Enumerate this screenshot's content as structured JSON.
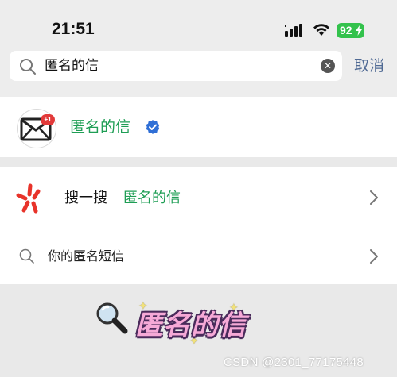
{
  "status_bar": {
    "time": "21:51",
    "battery": "92",
    "icons": [
      "signal-icon",
      "wifi-icon",
      "battery-icon"
    ]
  },
  "search": {
    "value": "匿名的信",
    "cancel_label": "取消",
    "icons": [
      "search-icon",
      "clear-icon"
    ]
  },
  "account_result": {
    "name": "匿名的信",
    "avatar_badge": "+1",
    "verified": true,
    "icons": [
      "envelope-avatar-icon",
      "verified-icon"
    ]
  },
  "sousou": {
    "prefix": "搜一搜",
    "query": "匿名的信",
    "icons": [
      "sousou-logo-icon",
      "chevron-right-icon"
    ]
  },
  "suggestion": {
    "text": "你的匿名短信",
    "icons": [
      "search-icon",
      "chevron-right-icon"
    ]
  },
  "sticker": {
    "text": "匿名的信",
    "icons": [
      "magnifier-emoji-icon",
      "sparkle-icon"
    ]
  },
  "watermark": {
    "text": "CSDN @2301_77175448"
  },
  "colors": {
    "accent_green": "#1f9e55",
    "link_blue": "#506a94",
    "battery_green": "#33c24c",
    "verified_blue": "#2f6fd6",
    "sousou_red": "#e8332a"
  }
}
